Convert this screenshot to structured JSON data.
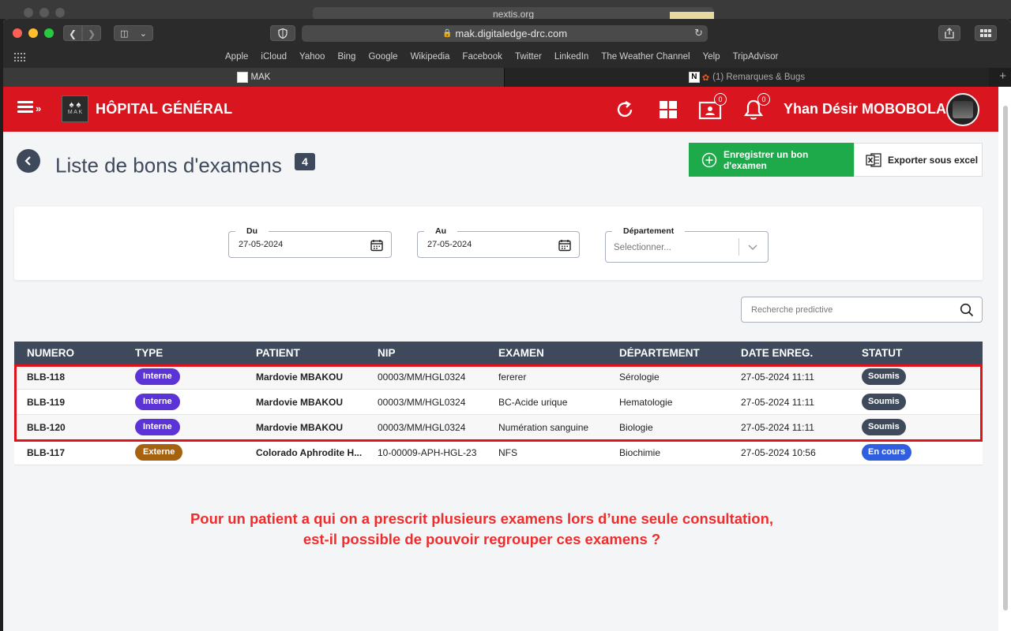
{
  "browser": {
    "background_url": "nextis.org",
    "url": "mak.digitaledge-drc.com",
    "bookmarks": [
      "Apple",
      "iCloud",
      "Yahoo",
      "Bing",
      "Google",
      "Wikipedia",
      "Facebook",
      "Twitter",
      "LinkedIn",
      "The Weather Channel",
      "Yelp",
      "TripAdvisor"
    ],
    "tabs": [
      {
        "label": "MAK",
        "active": true
      },
      {
        "label": "(1) Remarques & Bugs",
        "active": false
      }
    ]
  },
  "header": {
    "hospital_name": "HÔPITAL GÉNÉRAL",
    "logo_text": "M A K",
    "messages_badge": "0",
    "notifications_badge": "0",
    "user_name": "Yhan Désir MOBOBOLA"
  },
  "page": {
    "title": "Liste de bons d'examens",
    "count": "4",
    "add_button": "Enregistrer un bon d'examen",
    "export_button": "Exporter sous excel"
  },
  "filters": {
    "from_label": "Du",
    "from_value": "27-05-2024",
    "to_label": "Au",
    "to_value": "27-05-2024",
    "department_label": "Département",
    "department_placeholder": "Selectionner..."
  },
  "search": {
    "placeholder": "Recherche predictive"
  },
  "table": {
    "columns": [
      "NUMERO",
      "TYPE",
      "PATIENT",
      "NIP",
      "EXAMEN",
      "DÉPARTEMENT",
      "DATE ENREG.",
      "STATUT"
    ],
    "rows": [
      {
        "numero": "BLB-118",
        "type": "Interne",
        "patient": "Mardovie MBAKOU",
        "nip": "00003/MM/HGL0324",
        "examen": "fererer",
        "departement": "Sérologie",
        "date": "27-05-2024 11:11",
        "statut": "Soumis"
      },
      {
        "numero": "BLB-119",
        "type": "Interne",
        "patient": "Mardovie MBAKOU",
        "nip": "00003/MM/HGL0324",
        "examen": "BC-Acide urique",
        "departement": "Hematologie",
        "date": "27-05-2024 11:11",
        "statut": "Soumis"
      },
      {
        "numero": "BLB-120",
        "type": "Interne",
        "patient": "Mardovie MBAKOU",
        "nip": "00003/MM/HGL0324",
        "examen": "Numération sanguine",
        "departement": "Biologie",
        "date": "27-05-2024 11:11",
        "statut": "Soumis"
      },
      {
        "numero": "BLB-117",
        "type": "Externe",
        "patient": "Colorado Aphrodite H...",
        "nip": "10-00009-APH-HGL-23",
        "examen": "NFS",
        "departement": "Biochimie",
        "date": "27-05-2024 10:56",
        "statut": "En cours"
      }
    ]
  },
  "annotation": {
    "line1": "Pour un patient a qui on a prescrit plusieurs examens lors d’une seule consultation,",
    "line2": "est-il possible de pouvoir regrouper ces examens ?"
  },
  "colors": {
    "brand_red": "#d9151f",
    "header_dark": "#3e4a5c",
    "add_green": "#1eaa4a",
    "interne": "#5b33d6",
    "externe": "#a6620f",
    "en_cours": "#2f5ee0"
  },
  "icons": [
    "menu-icon",
    "refresh-icon",
    "grid-icon",
    "messages-icon",
    "bell-icon",
    "back-icon",
    "plus-circle-icon",
    "excel-icon",
    "calendar-icon",
    "chevron-down-icon",
    "search-icon"
  ]
}
